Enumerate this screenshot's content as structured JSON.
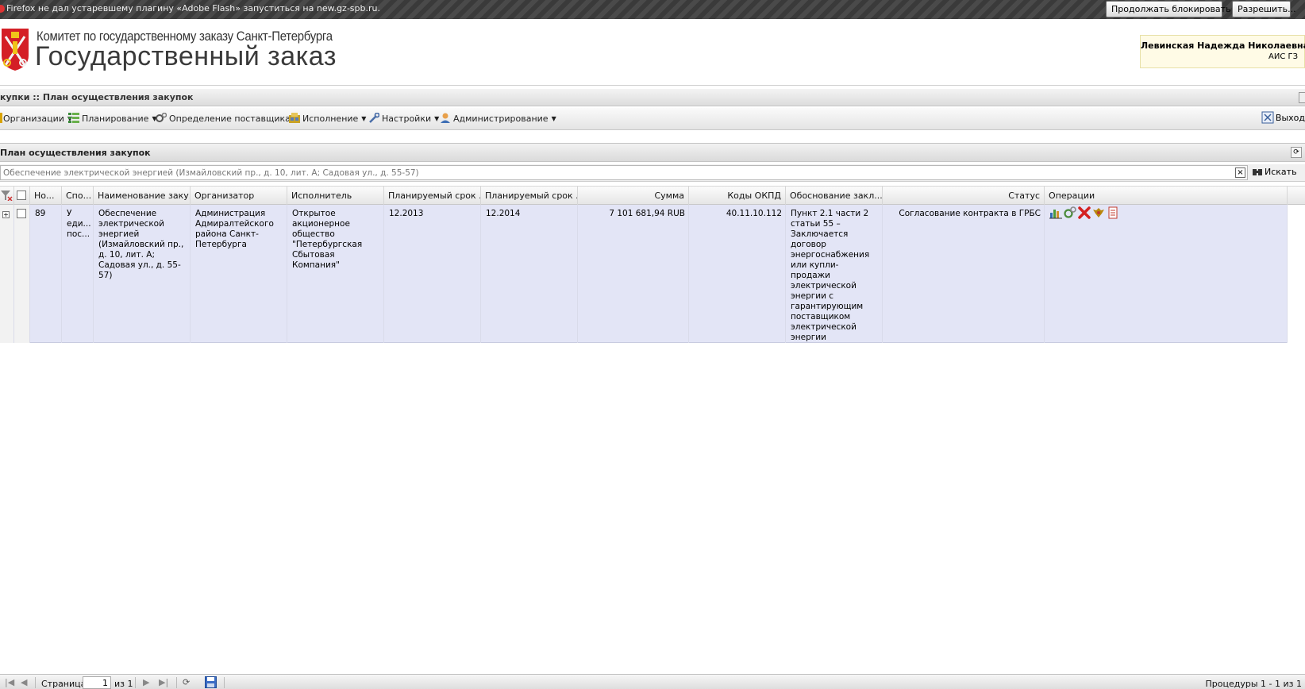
{
  "flashbar": {
    "message": "Firefox не дал устаревшему плагину «Adobe Flash» запуститься на new.gz-spb.ru.",
    "continue_blocking": "Продолжать блокировать",
    "allow": "Разрешить..."
  },
  "header": {
    "org_name": "Комитет по государственному заказу Санкт-Петербурга",
    "app_title": "Государственный заказ",
    "user_name": "Левинская Надежда Николаевна",
    "system": "АИС ГЗ"
  },
  "breadcrumb": "купки :: План осуществления закупок",
  "menu": {
    "items": [
      {
        "label": "Организации"
      },
      {
        "label": "Планирование"
      },
      {
        "label": "Определение поставщика"
      },
      {
        "label": "Исполнение"
      },
      {
        "label": "Настройки"
      },
      {
        "label": "Администрирование"
      }
    ],
    "exit": "Выход"
  },
  "panel": {
    "title": "План осуществления закупок",
    "search_value": "Обеспечение электрической энергией (Измайловский пр., д. 10, лит. А; Садовая ул., д. 55-57)",
    "search_button": "Искать"
  },
  "grid": {
    "columns": [
      "Но...",
      "Спо...",
      "Наименование заку...",
      "Организатор",
      "Исполнитель",
      "Планируемый срок ...",
      "Планируемый срок ...",
      "Сумма",
      "Коды ОКПД",
      "Обоснование закл...",
      "Статус",
      "Операции"
    ],
    "rows": [
      {
        "number": "89",
        "method": "У еди... пос...",
        "name": "Обеспечение электрической энергией (Измайловский пр., д. 10, лит. А; Садовая ул., д. 55-57)",
        "organizer": "Администрация Адмиралтейского района Санкт-Петербурга",
        "executor": "Открытое акционерное общество \"Петербургская Сбытовая Компания\"",
        "plan_date_1": "12.2013",
        "plan_date_2": "12.2014",
        "sum": "7 101 681,94 RUB",
        "okpd": "40.11.10.112",
        "basis": "Пункт 2.1 части 2 статьи 55 – Заключается договор энергоснабжения или купли-продажи электрической энергии с гарантирующим поставщиком электрической энергии",
        "status": "Согласование контракта в ГРБС"
      }
    ]
  },
  "pager": {
    "page_label": "Страница",
    "page_value": "1",
    "of_label": "из 1",
    "info": "Процедуры 1 - 1 из 1"
  }
}
